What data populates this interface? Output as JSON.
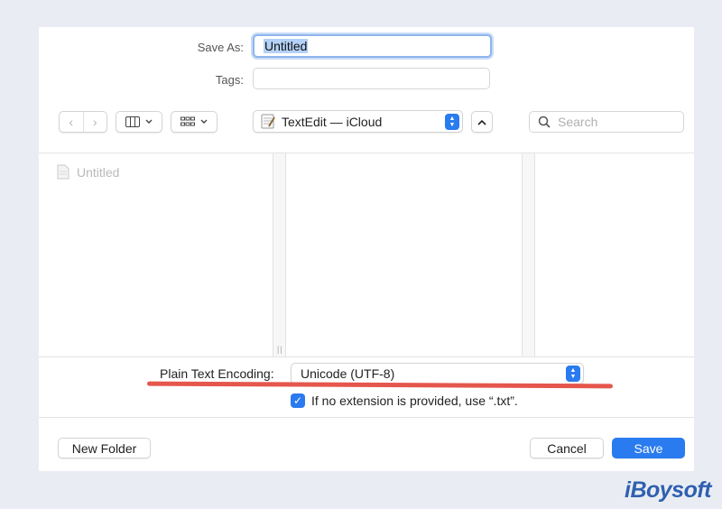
{
  "save_as": {
    "label": "Save As:",
    "value": "Untitled"
  },
  "tags": {
    "label": "Tags:",
    "value": ""
  },
  "toolbar": {
    "location": "TextEdit — iCloud",
    "search_placeholder": "Search"
  },
  "browser": {
    "items": [
      {
        "name": "Untitled"
      }
    ]
  },
  "encoding": {
    "label": "Plain Text Encoding:",
    "value": "Unicode (UTF-8)"
  },
  "extension_option": {
    "label": "If no extension is provided, use “.txt”.",
    "checked": true
  },
  "footer": {
    "new_folder": "New Folder",
    "cancel": "Cancel",
    "save": "Save"
  },
  "watermark": "iBoysoft",
  "colors": {
    "accent": "#2a7bef",
    "highlight_underline": "#e5564c",
    "background": "#e9edf3"
  }
}
